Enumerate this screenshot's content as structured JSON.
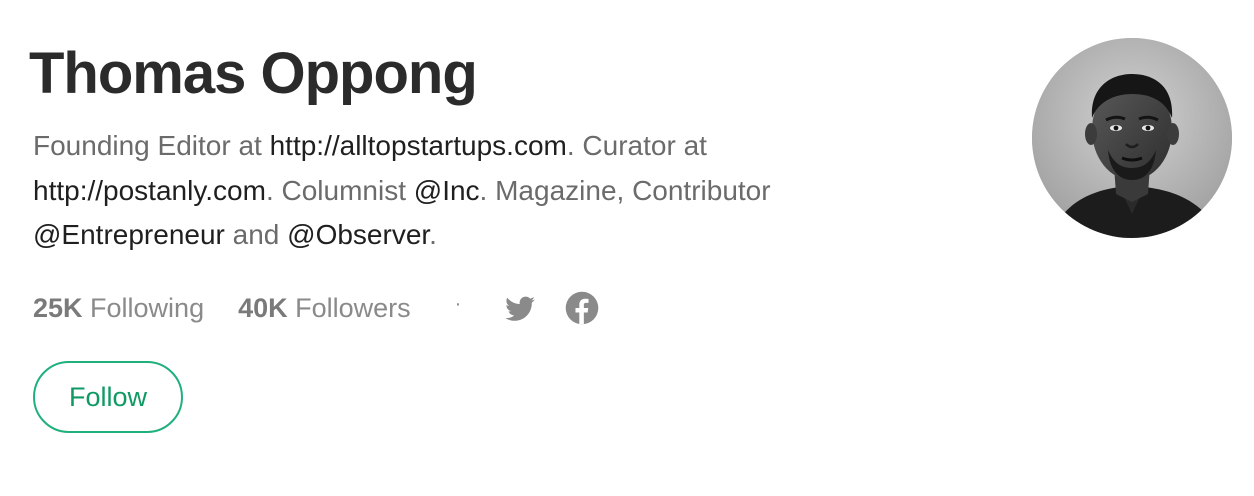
{
  "profile": {
    "name": "Thomas Oppong",
    "bio": {
      "t1": "Founding Editor at ",
      "link1": "http://alltopstartups.com",
      "t2": ". Curator at ",
      "link2": "http://postanly.com",
      "t3": ". Columnist ",
      "link3": "@Inc",
      "t4": ". Magazine, Contributor ",
      "link4": "@Entrepreneur",
      "t5": " and ",
      "link5": "@Observer",
      "t6": "."
    },
    "stats": {
      "following_count": "25K",
      "following_label": " Following",
      "followers_count": "40K",
      "followers_label": " Followers",
      "separator": "·"
    },
    "social": {
      "twitter_icon": "twitter-icon",
      "facebook_icon": "facebook-icon"
    },
    "follow_label": "Follow",
    "avatar_alt": "Thomas Oppong"
  },
  "colors": {
    "accent": "#1fb07c",
    "accent_text": "#0f9a64",
    "name": "#2b2b2b",
    "muted": "#6b6b6b",
    "link": "#1f1f1f",
    "icons": "#8a8a8a"
  }
}
